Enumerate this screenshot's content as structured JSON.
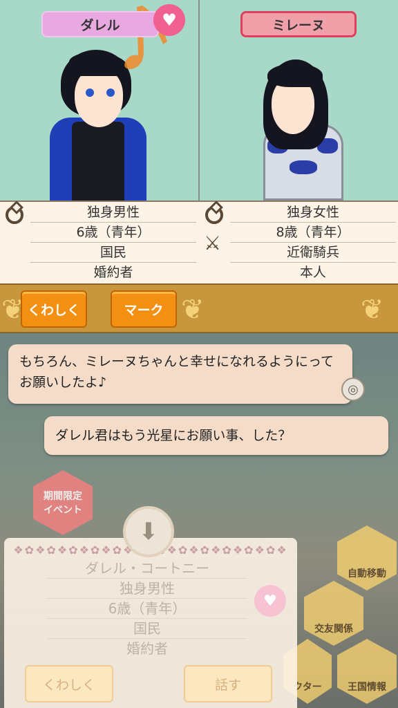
{
  "left_character": {
    "name": "ダレル",
    "rows": [
      "独身男性",
      "6歳（青年）",
      "国民",
      "婚約者"
    ]
  },
  "right_character": {
    "name": "ミレーヌ",
    "rows": [
      "独身女性",
      "8歳（青年）",
      "近衛騎兵",
      "本人"
    ]
  },
  "buttons": {
    "details": "くわしく",
    "mark": "マーク"
  },
  "chat": {
    "line1": "もちろん、ミレーヌちゃんと幸せになれるようにってお願いしたよ♪",
    "line2": "ダレル君はもう光星にお願い事、した？"
  },
  "side_menu": {
    "event": "期間限定\nイベント",
    "auto_move": "自動移動",
    "friendship": "交友関係",
    "character": "クター",
    "kingdom_info": "王国情報"
  },
  "panel": {
    "full_name": "ダレル・コートニー",
    "rows": [
      "独身男性",
      "6歳（青年）",
      "国民",
      "婚約者"
    ],
    "details_button": "くわしく",
    "talk_button": "話す"
  },
  "colors": {
    "portrait_bg": "#a8d8c8",
    "button_orange": "#f39012",
    "bar_gold": "#c8963c",
    "chat_bg": "#f5dcc8"
  },
  "icons": {
    "marriage": "ring-icon",
    "occupation": "crossed-swords-icon",
    "favorite": "heart-icon",
    "expand": "down-arrow-icon",
    "auto": "auto-talk-icon"
  }
}
